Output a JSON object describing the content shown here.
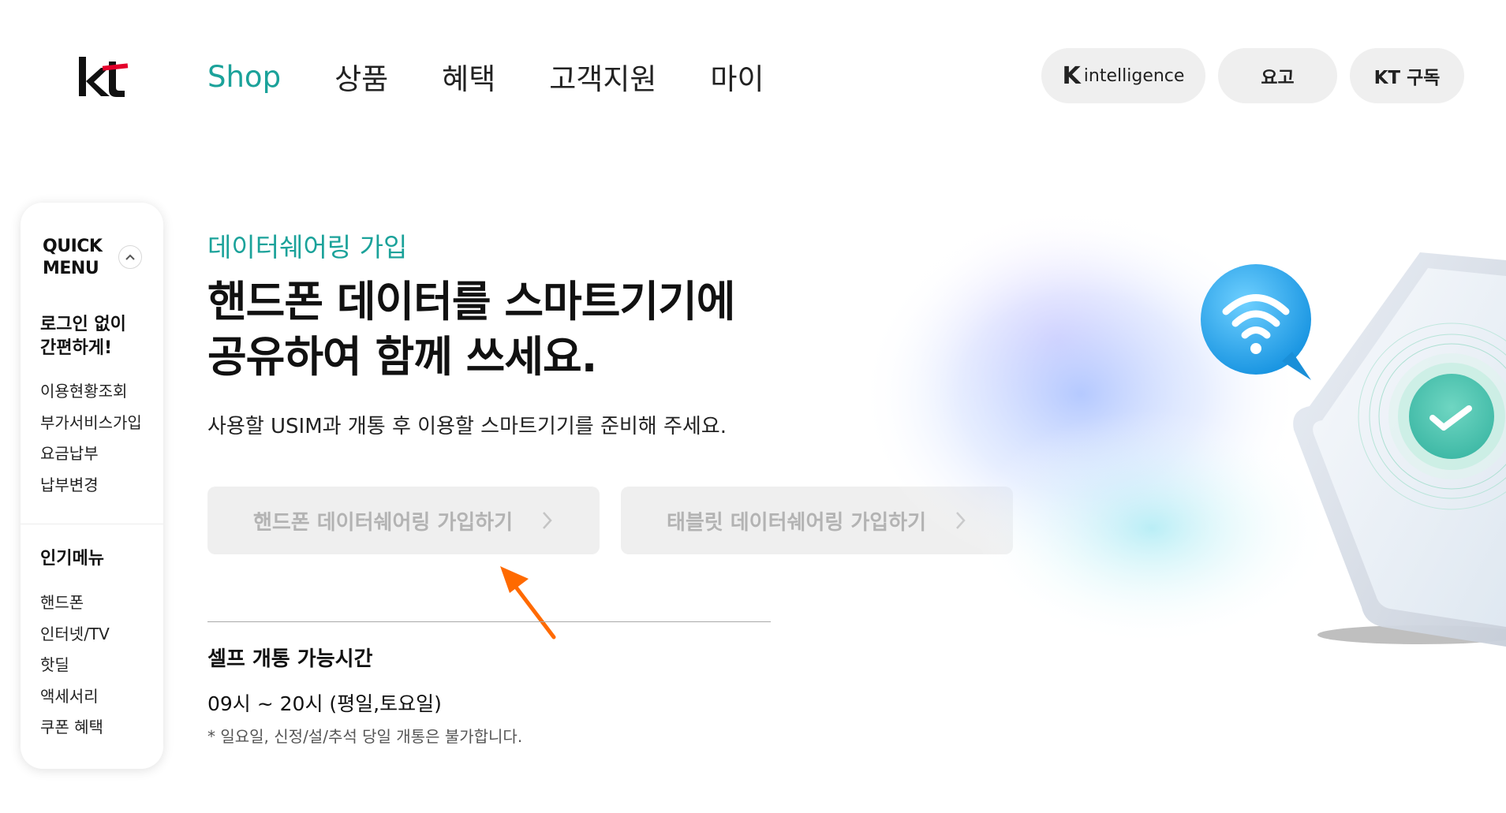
{
  "brand": {
    "logo_text": "kt",
    "accent_color": "#1ba29a",
    "logo_red": "#e4002b"
  },
  "nav": {
    "items": [
      {
        "label": "Shop",
        "active": true
      },
      {
        "label": "상품",
        "active": false
      },
      {
        "label": "혜택",
        "active": false
      },
      {
        "label": "고객지원",
        "active": false
      },
      {
        "label": "마이",
        "active": false
      }
    ]
  },
  "header_buttons": {
    "k_intelligence_mark": "K",
    "k_intelligence_text": "intelligence",
    "yogo": "요고",
    "kt_subscribe": "KT 구독"
  },
  "quick_menu": {
    "title_line1": "QUICK",
    "title_line2": "MENU",
    "toggle_icon": "chevron-up-icon",
    "guest_title_line1": "로그인 없이",
    "guest_title_line2": "간편하게!",
    "guest_items": [
      "이용현황조회",
      "부가서비스가입",
      "요금납부",
      "납부변경"
    ],
    "popular_title": "인기메뉴",
    "popular_items": [
      "핸드폰",
      "인터넷/TV",
      "핫딜",
      "액세서리",
      "쿠폰 혜택"
    ]
  },
  "main": {
    "eyebrow": "데이터쉐어링 가입",
    "headline_line1": "핸드폰 데이터를 스마트기기에",
    "headline_line2": "공유하여 함께 쓰세요.",
    "subtitle": "사용할 USIM과 개통 후 이용할 스마트기기를 준비해 주세요.",
    "cta_phone": "핸드폰 데이터쉐어링 가입하기",
    "cta_tablet": "태블릿 데이터쉐어링 가입하기",
    "hours_title": "셀프 개통 가능시간",
    "hours_value": "09시 ~ 20시 (평일,토요일)",
    "hours_note": "* 일요일, 신정/설/추석 당일 개통은 불가합니다."
  },
  "annotation": {
    "pointer_color": "#ff6a00",
    "pointer_icon": "arrow-pointer-icon"
  },
  "illustration": {
    "bubble_icon": "wifi-icon",
    "check_icon": "check-icon"
  }
}
